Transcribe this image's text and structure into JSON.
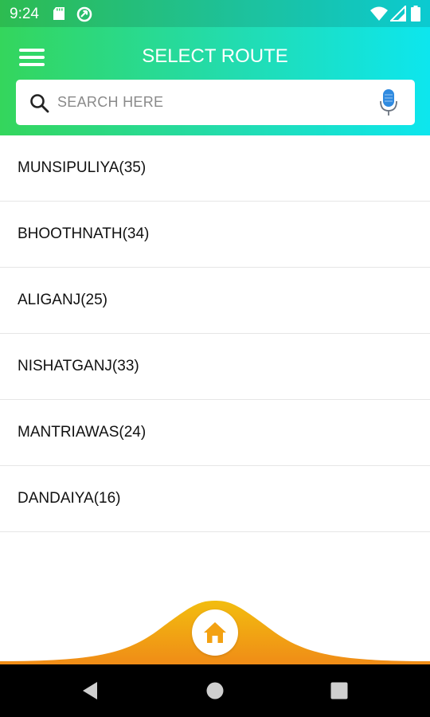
{
  "status_bar": {
    "time": "9:24"
  },
  "header": {
    "title": "SELECT ROUTE"
  },
  "search": {
    "placeholder": "SEARCH HERE",
    "value": ""
  },
  "routes": [
    {
      "label": "MUNSIPULIYA(35)"
    },
    {
      "label": "BHOOTHNATH(34)"
    },
    {
      "label": "ALIGANJ(25)"
    },
    {
      "label": "NISHATGANJ(33)"
    },
    {
      "label": "MANTRIAWAS(24)"
    },
    {
      "label": "DANDAIYA(16)"
    }
  ],
  "colors": {
    "header_gradient_start": "#34d65c",
    "header_gradient_end": "#0de6ee",
    "wave_top": "#f2bd0f",
    "wave_bottom": "#f08c17",
    "home_icon": "#f3a112",
    "mic": "#2f8ae0"
  },
  "icons": {
    "status": [
      "sd-card-icon",
      "sync-icon",
      "wifi-icon",
      "signal-icon",
      "battery-icon"
    ],
    "header": [
      "menu-icon"
    ],
    "search": [
      "search-icon",
      "mic-icon"
    ],
    "bottom": [
      "home-icon"
    ],
    "nav": [
      "back-icon",
      "home-circle-icon",
      "recents-icon"
    ]
  }
}
